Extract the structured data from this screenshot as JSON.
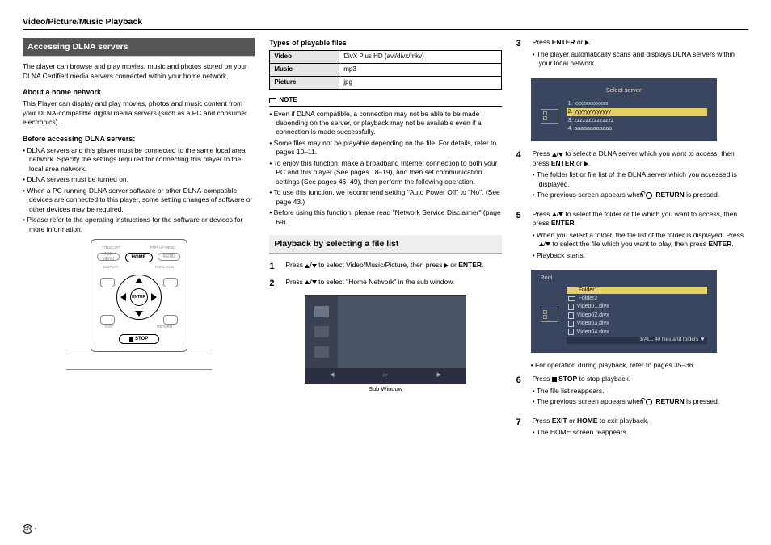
{
  "header": "Video/Picture/Music Playback",
  "footer_badge": "EN",
  "col1": {
    "banner": "Accessing DLNA servers",
    "intro": "The player can browse and play movies, music and photos stored on your DLNA Certified media servers connected within your home network.",
    "about_h": "About a home network",
    "about_p": "This Player can display and play movies, photos and music content from your DLNA-compatible digital media servers (such as a PC and consumer electronics).",
    "before_h": "Before accessing DLNA servers:",
    "before": [
      "DLNA servers and this player must be connected to the same local area network. Specify the settings required for connecting this player to the local area network.",
      "DLNA servers must be turned on.",
      "When a PC running DLNA server software or other DLNA-compatible devices are connected to this player, some setting changes of software or other devices may be required.",
      "Please refer to the operating instructions for the software or devices for more information."
    ],
    "remote": {
      "home": "HOME",
      "enter": "ENTER",
      "stop": "STOP",
      "display": "DISPLAY",
      "function": "FUNCTION",
      "exit": "EXIT",
      "return": "RETURN",
      "titlelist": "TITLE LIST",
      "topmenu": "TOP MENU",
      "popup": "POP-UP MENU"
    }
  },
  "col2": {
    "types_h": "Types of playable files",
    "tbl": {
      "r1k": "Video",
      "r1v": "DivX Plus HD (avi/divx/mkv)",
      "r2k": "Music",
      "r2v": "mp3",
      "r3k": "Picture",
      "r3v": "jpg"
    },
    "note_h": "NOTE",
    "notes": [
      "Even if DLNA compatible, a connection may not be able to be made depending on the server, or playback may not be available even if a connection is made successfully.",
      "Some files may not be playable depending on the file. For details, refer to pages 10–11.",
      "To enjoy this function, make a broadband Internet connection to both your PC and this player (See pages 18–19), and then set communication settings (See pages 46–49), then perform the following operation.",
      "To use this function, we recommend setting \"Auto Power Off\" to \"No\". (See page 43.)",
      "Before using this function, please read \"Network Service Disclaimer\" (page 69)."
    ],
    "banner2": "Playback by selecting a file list",
    "step1": "Press ▲/▼ to select Video/Music/Picture, then press ▶ or ENTER.",
    "step2": "Press ▲/▼ to select \"Home Network\" in the sub window.",
    "subwin_cap": "Sub Window"
  },
  "col3": {
    "step3": "Press ENTER or ▶.",
    "step3b": [
      "The player automatically scans and displays DLNA servers within your local network."
    ],
    "osd1": {
      "title": "Select server",
      "items": [
        "1. xxxxxxxxxxxx",
        "2. yyyyyyyyyyyyy",
        "3. zzzzzzzzzzzzzz",
        "4. aaaaaaaaaaaa"
      ]
    },
    "step4": "Press ▲/▼ to select a DLNA server which you want to access, then press ENTER or ▶.",
    "step4b": [
      "The folder list or file list of the DLNA server which you accessed is displayed.",
      "The previous screen appears when   RETURN is pressed."
    ],
    "step5": "Press ▲/▼ to select the folder or file which you want to access, then press ENTER.",
    "step5b": [
      "When you select a folder, the file list of the folder is displayed. Press ▲/▼ to select the file which you want to play, then press ENTER.",
      "Playback starts."
    ],
    "osd2": {
      "title": "Root",
      "items": [
        "Folder1",
        "Folder2",
        "Video01.divx",
        "Video02.divx",
        "Video03.divx",
        "Video04.divx"
      ],
      "status": "1/ALL  40 files and folders  ▼"
    },
    "post1": "For operation during playback, refer to pages 35–36.",
    "step6": "Press ■ STOP  to stop playback.",
    "step6b": [
      "The file list reappears.",
      "The previous screen appears when   RETURN is pressed."
    ],
    "step7": "Press EXIT or HOME to exit playback.",
    "step7b": [
      "The HOME screen reappears."
    ]
  }
}
